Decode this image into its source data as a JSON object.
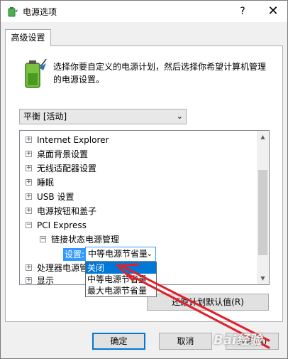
{
  "window": {
    "title": "电源选项",
    "help_label": "?",
    "close_label": "✕"
  },
  "tabs": [
    {
      "label": "高级设置"
    }
  ],
  "description": "选择你要自定义的电源计划，然后选择你希望计算机管理的电源设置。",
  "plan_select": {
    "value": "平衡 [活动]"
  },
  "tree": {
    "items": [
      {
        "expander": "+",
        "label": "Internet Explorer"
      },
      {
        "expander": "+",
        "label": "桌面背景设置"
      },
      {
        "expander": "+",
        "label": "无线适配器设置"
      },
      {
        "expander": "+",
        "label": "睡眠"
      },
      {
        "expander": "+",
        "label": "USB 设置"
      },
      {
        "expander": "+",
        "label": "电源按钮和盖子"
      },
      {
        "expander": "−",
        "label": "PCI Express"
      },
      {
        "expander": "−",
        "label": "链接状态电源管理"
      },
      {
        "expander": "+",
        "label": "处理器电源管"
      },
      {
        "expander": "+",
        "label": "显示"
      }
    ],
    "setting_label": "设置:",
    "setting_value": "中等电源节省量"
  },
  "dropdown": {
    "options": [
      {
        "label": "关闭",
        "selected": true
      },
      {
        "label": "中等电源节省量",
        "selected": false
      },
      {
        "label": "最大电源节省量",
        "selected": false
      }
    ]
  },
  "buttons": {
    "restore": "还原计划默认值(R)",
    "ok": "确定",
    "cancel": "取消",
    "apply": "应用(A)"
  },
  "watermark": "Bai经验",
  "colors": {
    "selection": "#0078d7",
    "annotation_arrow": "#e0202a"
  }
}
